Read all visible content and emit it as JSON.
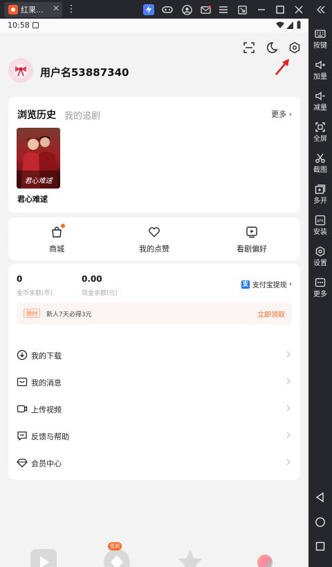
{
  "emulator": {
    "tab_title": "红果...",
    "tab_close": "✕",
    "sidebar": [
      {
        "label": "按键",
        "icon": "keyboard-icon"
      },
      {
        "label": "加量",
        "icon": "volume-up-icon"
      },
      {
        "label": "减量",
        "icon": "volume-down-icon"
      },
      {
        "label": "全屏",
        "icon": "fullscreen-icon"
      },
      {
        "label": "截图",
        "icon": "scissors-icon"
      },
      {
        "label": "多开",
        "icon": "multi-instance-icon"
      },
      {
        "label": "安装",
        "icon": "apk-install-icon"
      },
      {
        "label": "设置",
        "icon": "settings-hexagon-icon"
      },
      {
        "label": "更多",
        "icon": "more-icon"
      }
    ],
    "apk_text": "APK"
  },
  "status_bar": {
    "time": "10:58"
  },
  "profile": {
    "username": "用户名53887340"
  },
  "history": {
    "tab_active": "浏览历史",
    "tab_inactive": "我的追剧",
    "more": "更多",
    "item_title": "君心难逑",
    "poster_caption": "君心难逑"
  },
  "quick_actions": [
    {
      "label": "商城",
      "icon": "shopping-bag-icon"
    },
    {
      "label": "我的点赞",
      "icon": "heart-icon"
    },
    {
      "label": "看剧偏好",
      "icon": "play-preference-icon"
    }
  ],
  "wallet": {
    "coins_value": "0",
    "coins_label": "金币余额(币)",
    "cash_value": "0.00",
    "cash_label": "现金余额(元)",
    "alipay_label": "支付宝提现",
    "alipay_glyph": "支",
    "promo_badge": "限时",
    "promo_text": "新人7天必得3元",
    "promo_action": "立即领取"
  },
  "menu": [
    {
      "label": "我的下载",
      "icon": "download-icon"
    },
    {
      "label": "我的消息",
      "icon": "message-icon"
    },
    {
      "label": "上传视频",
      "icon": "upload-video-icon"
    },
    {
      "label": "反馈与帮助",
      "icon": "feedback-icon"
    },
    {
      "label": "会员中心",
      "icon": "vip-diamond-icon"
    }
  ],
  "bottom_nav": {
    "sign_badge": "签到"
  },
  "colors": {
    "accent": "#ff6a2a",
    "alipay": "#1677ff",
    "arrow": "#e02020",
    "emulator_bg": "#25272c"
  }
}
